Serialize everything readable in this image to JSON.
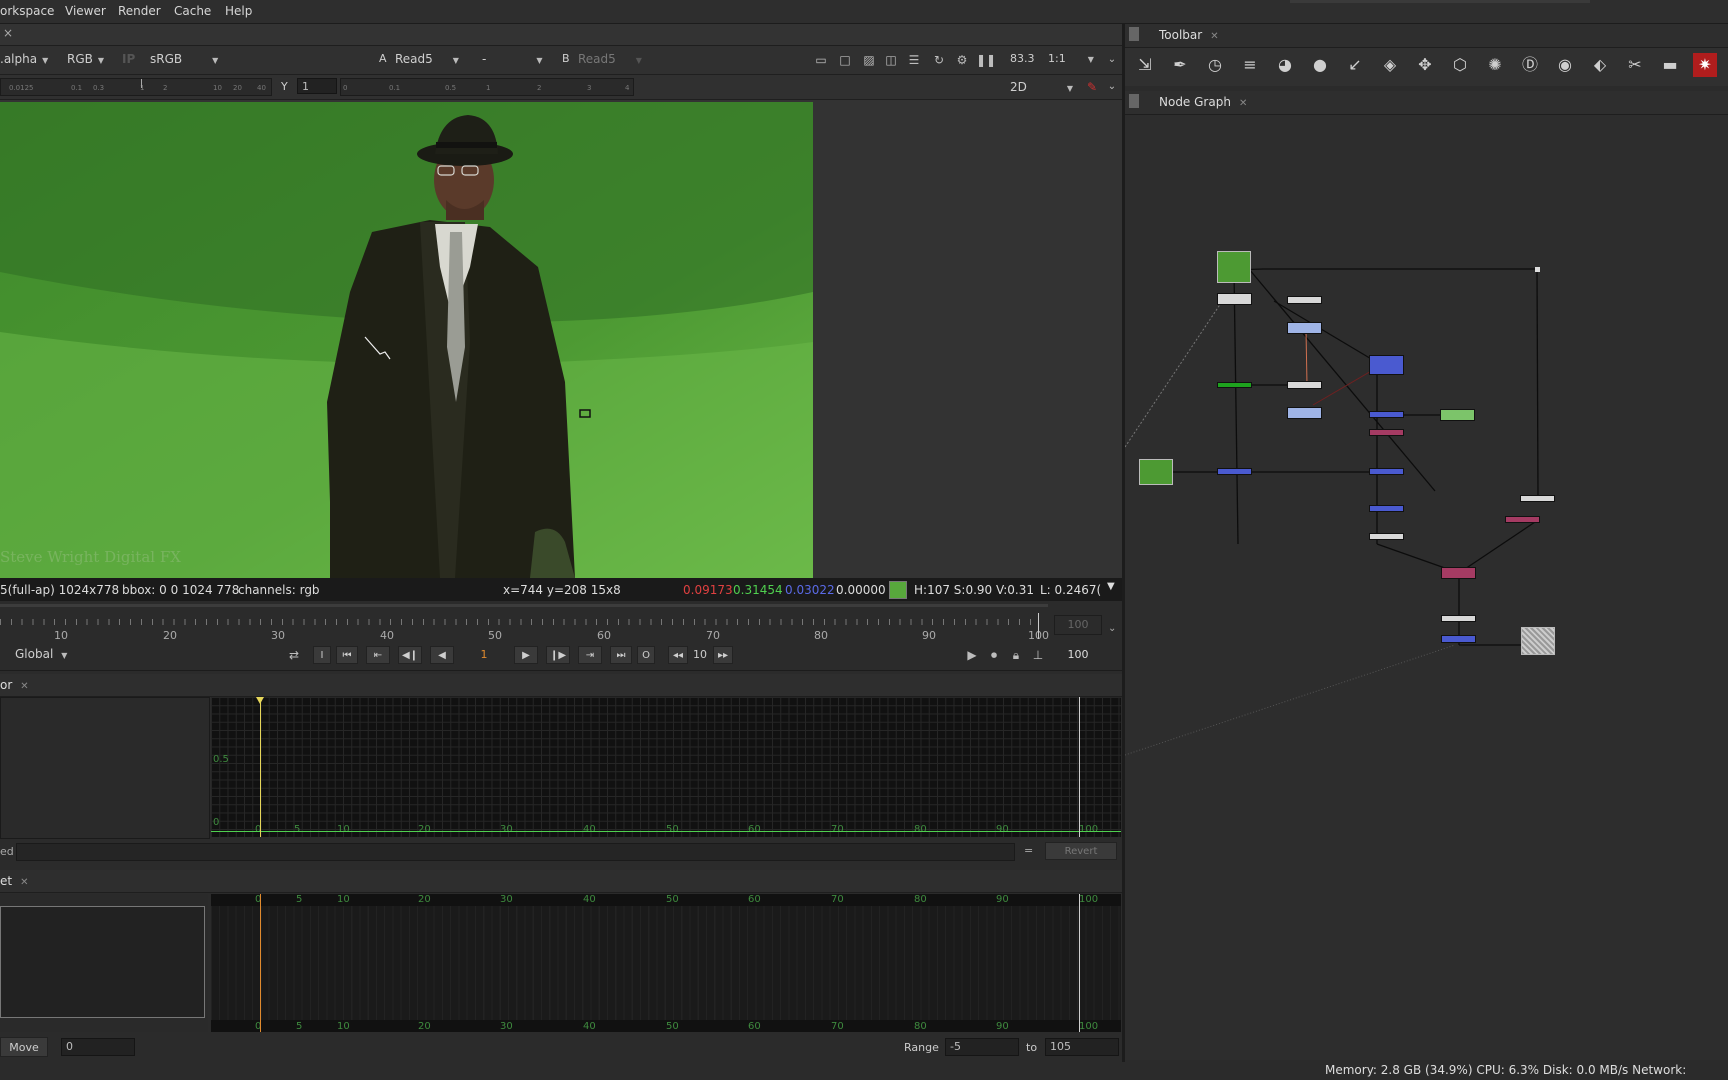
{
  "menu": {
    "items": [
      "orkspace",
      "Viewer",
      "Render",
      "Cache",
      "Help"
    ]
  },
  "viewer": {
    "tab_close": "×",
    "channel_layer": ".alpha",
    "channel_mode": "RGB",
    "ip_label": "IP",
    "colorspace": "sRGB",
    "input_a_label": "A",
    "input_a": "Read5",
    "merge_op": "-",
    "input_b_label": "B",
    "input_b": "Read5",
    "zoom": "83.3",
    "ratio": "1:1",
    "gain_ticks": [
      "0.0125",
      "0.1",
      "0.3",
      "1",
      "2",
      "10",
      "20",
      "40"
    ],
    "gamma_label": "Y",
    "gamma_value": "1",
    "gamma_ticks": [
      "0",
      "0.1",
      "0.5",
      "1",
      "2",
      "3",
      "4"
    ],
    "view_mode": "2D",
    "image_watermark": "Steve Wright Digital FX",
    "info": {
      "format": "5(full-ap) 1024x778",
      "bbox": "bbox: 0 0 1024 778",
      "channels": "channels: rgb",
      "coords": "x=744 y=208 15x8",
      "r": "0.09173",
      "g": "0.31454",
      "b": "0.03022",
      "a": "0.00000",
      "swatch_color": "#58a83c",
      "hsv": "H:107 S:0.90 V:0.31",
      "lum": "L: 0.2467("
    }
  },
  "timeline": {
    "ruler_labels": [
      "10",
      "20",
      "30",
      "40",
      "50",
      "60",
      "70",
      "80",
      "90",
      "100"
    ],
    "end_frame_field": "100",
    "global_label": "Global",
    "in_btn": "I",
    "out_btn": "O",
    "current_frame": "1",
    "increment": "10",
    "out_frame": "100"
  },
  "curve_editor": {
    "tab_label": "or",
    "y_labels": [
      "0.5",
      "0"
    ],
    "x_labels": [
      "0",
      "5",
      "10",
      "20",
      "30",
      "40",
      "50",
      "60",
      "70",
      "80",
      "90",
      "100"
    ],
    "expr_label": "ed",
    "equals": "=",
    "revert_label": "Revert"
  },
  "dope_sheet": {
    "tab_label": "et",
    "x_labels": [
      "0",
      "5",
      "10",
      "20",
      "30",
      "40",
      "50",
      "60",
      "70",
      "80",
      "90",
      "100"
    ],
    "move_label": "Move",
    "move_value": "0",
    "range_label": "Range",
    "range_from": "-5",
    "to_label": "to",
    "range_to": "105"
  },
  "toolbar": {
    "tab_label": "Toolbar",
    "icons": [
      "image-icon",
      "draw-icon",
      "time-icon",
      "channel-icon",
      "color-icon",
      "filter-icon",
      "keyer-icon",
      "merge-icon",
      "transform-icon",
      "3d-icon",
      "particles-icon",
      "deep-icon",
      "views-icon",
      "metadata-icon",
      "other-icon",
      "furnace-icon",
      "nukex-icon"
    ]
  },
  "node_graph": {
    "tab_label": "Node Graph"
  },
  "status": {
    "text": "Memory: 2.8 GB (34.9%) CPU: 6.3% Disk: 0.0 MB/s Network:"
  },
  "colors": {
    "accent_yellow": "#e6d65a",
    "timeline_orange": "#e08a2e",
    "value_red": "#e04040",
    "value_green": "#4fcf4f",
    "value_blue": "#5a6ae6"
  }
}
